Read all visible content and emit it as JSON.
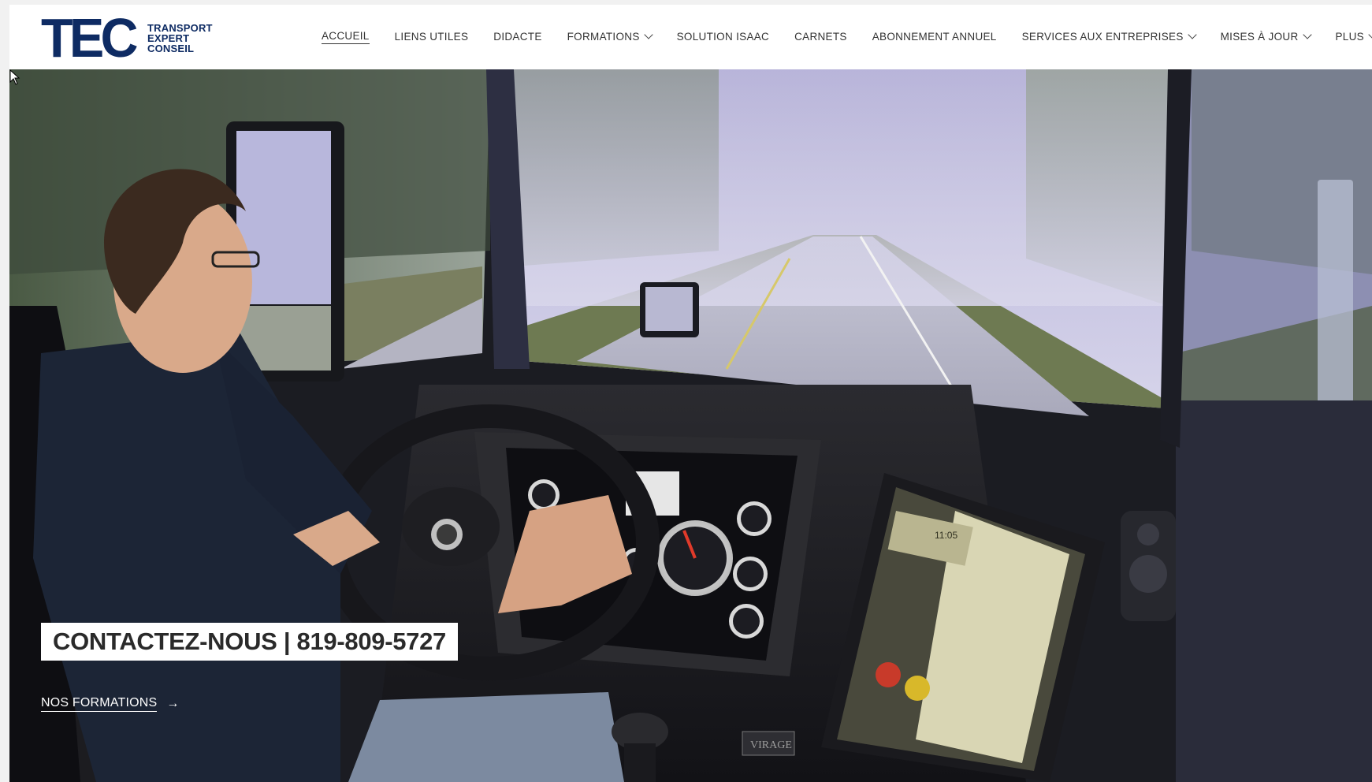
{
  "header": {
    "logo": {
      "mark": "TEC",
      "lines": [
        "TRANSPORT",
        "EXPERT",
        "CONSEIL"
      ]
    },
    "nav": [
      {
        "label": "ACCUEIL",
        "active": true,
        "dropdown": false
      },
      {
        "label": "LIENS UTILES",
        "active": false,
        "dropdown": false
      },
      {
        "label": "DIDACTE",
        "active": false,
        "dropdown": false
      },
      {
        "label": "FORMATIONS",
        "active": false,
        "dropdown": true
      },
      {
        "label": "SOLUTION ISAAC",
        "active": false,
        "dropdown": false
      },
      {
        "label": "CARNETS",
        "active": false,
        "dropdown": false
      },
      {
        "label": "ABONNEMENT ANNUEL",
        "active": false,
        "dropdown": false
      },
      {
        "label": "SERVICES AUX ENTREPRISES",
        "active": false,
        "dropdown": true
      },
      {
        "label": "MISES À JOUR",
        "active": false,
        "dropdown": true
      },
      {
        "label": "PLUS",
        "active": false,
        "dropdown": true
      }
    ]
  },
  "hero": {
    "image": "truck-driving-simulator-photo",
    "contact_banner": "CONTACTEZ-NOUS | 819-809-5727",
    "link_label": "NOS FORMATIONS",
    "link_arrow": "→",
    "dash_brand_label": "VIRAGE",
    "screen_clock": "11:05"
  },
  "colors": {
    "brand": "#0e2b63",
    "nav_text": "#333333",
    "header_bg": "#ffffff"
  }
}
